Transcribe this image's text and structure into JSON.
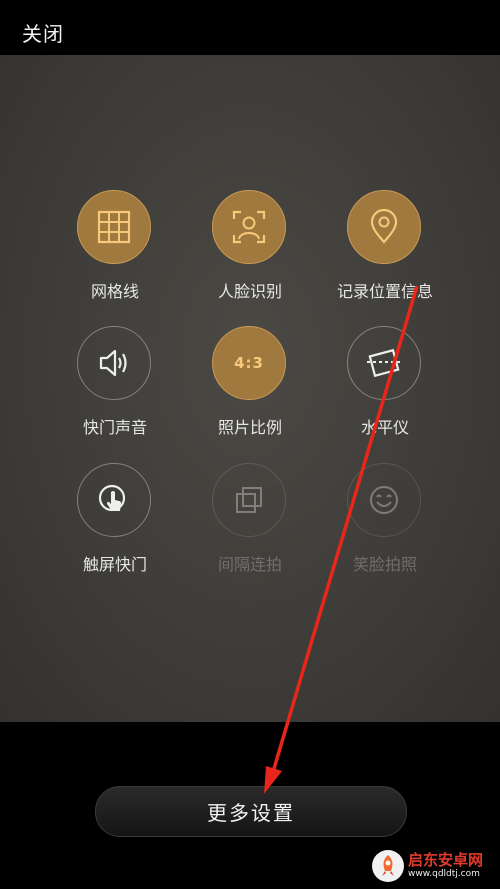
{
  "header": {
    "close_label": "关闭"
  },
  "settings": [
    {
      "label": "网格线",
      "icon": "grid-icon",
      "state": "active"
    },
    {
      "label": "人脸识别",
      "icon": "face-detect-icon",
      "state": "active"
    },
    {
      "label": "记录位置信息",
      "icon": "location-pin-icon",
      "state": "active"
    },
    {
      "label": "快门声音",
      "icon": "speaker-icon",
      "state": "inactive"
    },
    {
      "label": "照片比例",
      "icon": "aspect-ratio-icon",
      "state": "active",
      "icon_text": "4:3"
    },
    {
      "label": "水平仪",
      "icon": "level-icon",
      "state": "inactive"
    },
    {
      "label": "触屏快门",
      "icon": "touch-shutter-icon",
      "state": "inactive"
    },
    {
      "label": "间隔连拍",
      "icon": "burst-icon",
      "state": "disabled"
    },
    {
      "label": "笑脸拍照",
      "icon": "smile-icon",
      "state": "disabled"
    }
  ],
  "footer": {
    "more_settings_label": "更多设置"
  },
  "watermark": {
    "title": "启东安卓网",
    "url": "www.qdldtj.com"
  },
  "colors": {
    "accent": "#f7c97a",
    "active_fill": "#a0793f",
    "arrow": "#e8261c"
  }
}
